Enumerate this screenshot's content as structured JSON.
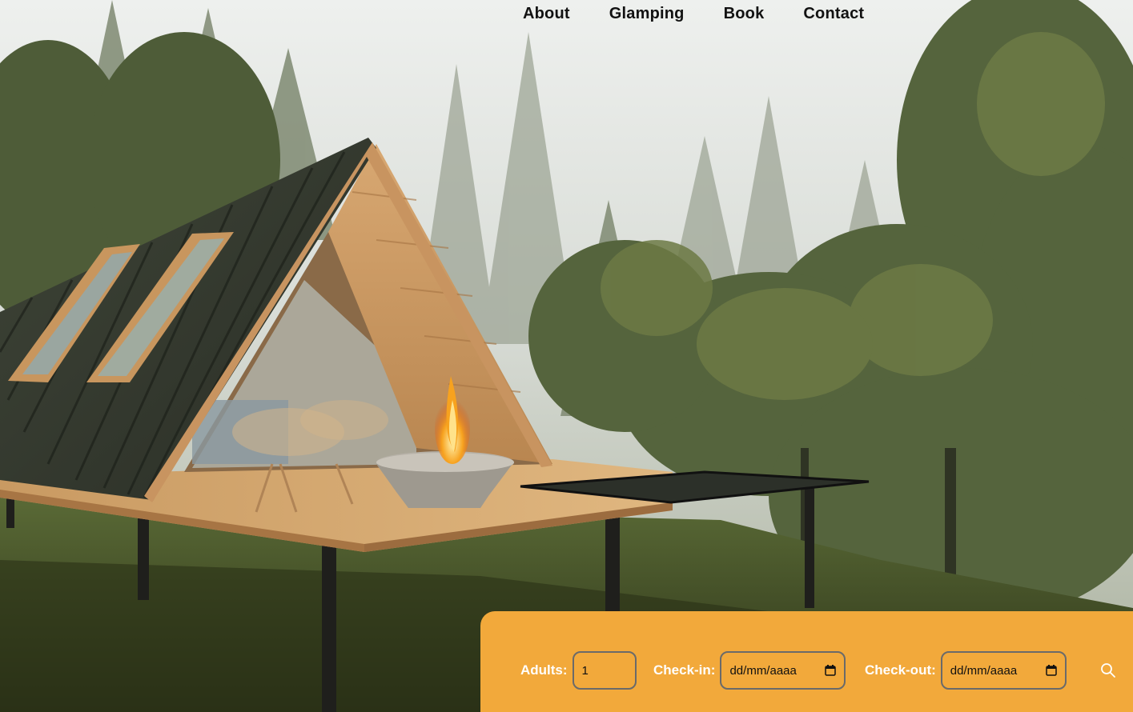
{
  "nav": {
    "items": [
      "About",
      "Glamping",
      "Book",
      "Contact"
    ]
  },
  "booking": {
    "adults_label": "Adults:",
    "adults_value": "1",
    "checkin_label": "Check-in:",
    "checkin_value": "dd/mm/aaaa",
    "checkout_label": "Check-out:",
    "checkout_value": "dd/mm/aaaa",
    "search_icon": "search-icon",
    "calendar_icon": "calendar-icon"
  },
  "colors": {
    "booking_bg": "#f2a93b",
    "nav_text": "#121212",
    "label_text": "#ffffff"
  }
}
